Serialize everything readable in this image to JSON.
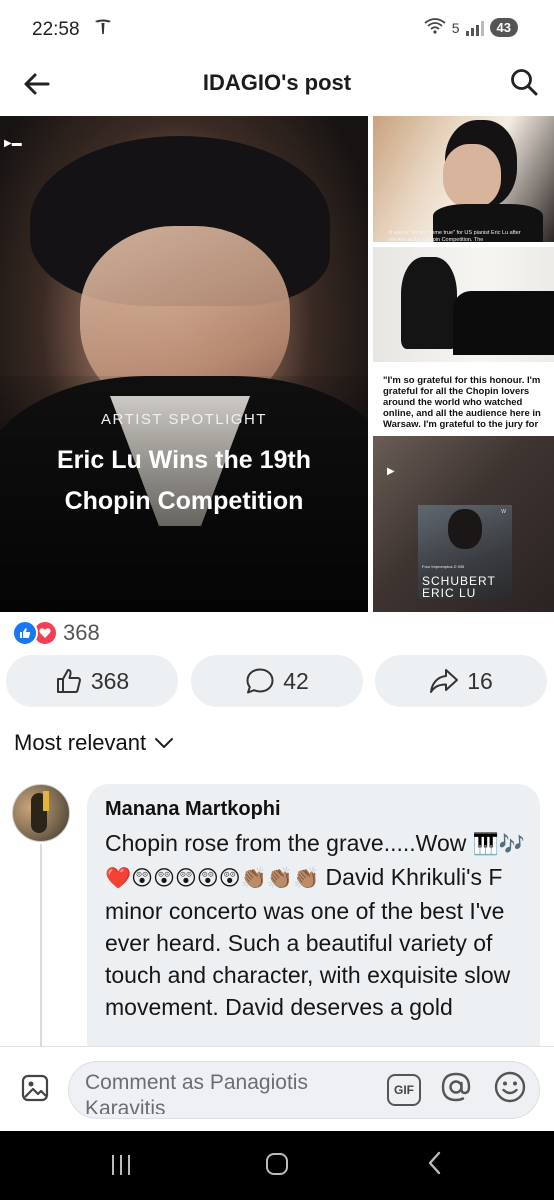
{
  "status_bar": {
    "time": "22:58",
    "network_icon": "tesla-icon",
    "wifi_label": "5",
    "battery": "43"
  },
  "header": {
    "title": "IDAGIO's post"
  },
  "post": {
    "main_photo": {
      "label": "ARTIST SPOTLIGHT",
      "title": "Eric Lu Wins the 19th Chopin Competition"
    },
    "side_photo_1_caption": "It was a \"dream come true\" for US pianist Eric Lu after his win at the Chopin Competition. The",
    "side_photo_3_quote": "\"I'm so grateful for this honour. I'm grateful for all the Chopin lovers around the world who watched online, and all the audience here in Warsaw. I'm grateful to the jury for",
    "album": {
      "logo": "W",
      "subtitle": "Four Impromptus D 935",
      "line1": "SCHUBERT",
      "line2": "ERIC LU"
    }
  },
  "reactions": {
    "count": "368",
    "like_color": "#1877f2",
    "love_color": "#f33e58"
  },
  "actions": {
    "like_count": "368",
    "comment_count": "42",
    "share_count": "16"
  },
  "sort": {
    "label": "Most relevant"
  },
  "comment": {
    "author": "Manana Martkophi",
    "text_before": "Chopin rose from the grave.....Wow",
    "emojis": [
      "🎹",
      "🎶",
      "❤️",
      "😲",
      "😲",
      "😲",
      "😲",
      "😲",
      "👏🏽",
      "👏🏽",
      "👏🏽"
    ],
    "text_after": "David Khrikuli's F minor concerto was one of the best I've ever heard. Such a beautiful variety of touch and character, with exquisite slow movement. David deserves a gold"
  },
  "composer": {
    "placeholder": "Comment as Panagiotis Karavitis",
    "gif_label": "GIF"
  }
}
